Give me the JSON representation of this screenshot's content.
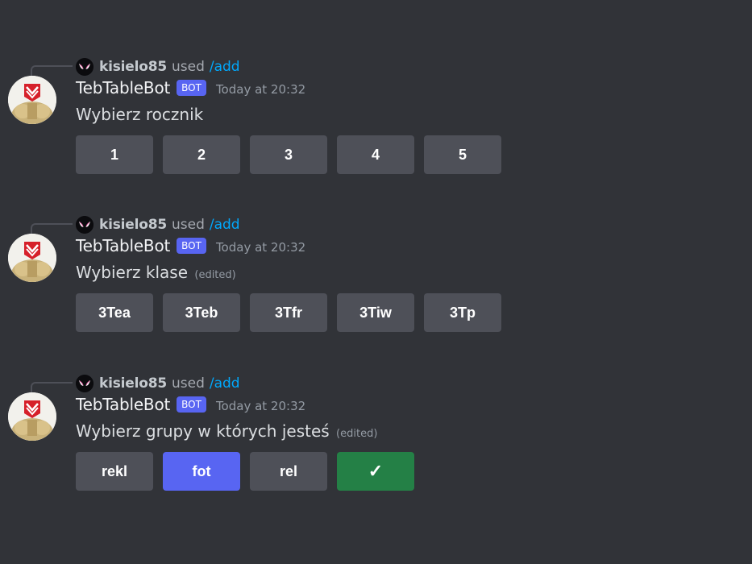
{
  "messages": [
    {
      "reply": {
        "user": "kisielo85",
        "used": "used",
        "command": "/add"
      },
      "author": "TebTableBot",
      "bot_tag": "BOT",
      "timestamp": "Today at 20:32",
      "content": "Wybierz rocznik",
      "edited": "",
      "buttons": [
        {
          "label": "1",
          "style": "secondary"
        },
        {
          "label": "2",
          "style": "secondary"
        },
        {
          "label": "3",
          "style": "secondary"
        },
        {
          "label": "4",
          "style": "secondary"
        },
        {
          "label": "5",
          "style": "secondary"
        }
      ]
    },
    {
      "reply": {
        "user": "kisielo85",
        "used": "used",
        "command": "/add"
      },
      "author": "TebTableBot",
      "bot_tag": "BOT",
      "timestamp": "Today at 20:32",
      "content": "Wybierz klase",
      "edited": "(edited)",
      "buttons": [
        {
          "label": "3Tea",
          "style": "secondary"
        },
        {
          "label": "3Teb",
          "style": "secondary"
        },
        {
          "label": "3Tfr",
          "style": "secondary"
        },
        {
          "label": "3Tiw",
          "style": "secondary"
        },
        {
          "label": "3Tp",
          "style": "secondary"
        }
      ]
    },
    {
      "reply": {
        "user": "kisielo85",
        "used": "used",
        "command": "/add"
      },
      "author": "TebTableBot",
      "bot_tag": "BOT",
      "timestamp": "Today at 20:32",
      "content": "Wybierz grupy w których jesteś",
      "edited": "(edited)",
      "buttons": [
        {
          "label": "rekl",
          "style": "secondary"
        },
        {
          "label": "fot",
          "style": "primary"
        },
        {
          "label": "rel",
          "style": "secondary"
        },
        {
          "label": "✓",
          "style": "success"
        }
      ]
    }
  ],
  "colors": {
    "background": "#313338",
    "secondary_button": "#4e5058",
    "primary_button": "#5865f2",
    "success_button": "#248046",
    "bot_tag": "#5865f2",
    "command_link": "#00a8fc"
  },
  "icons": {
    "reply_avatar": "spider-mask-avatar-icon",
    "bot_avatar": "tebtablebot-avatar-icon"
  }
}
